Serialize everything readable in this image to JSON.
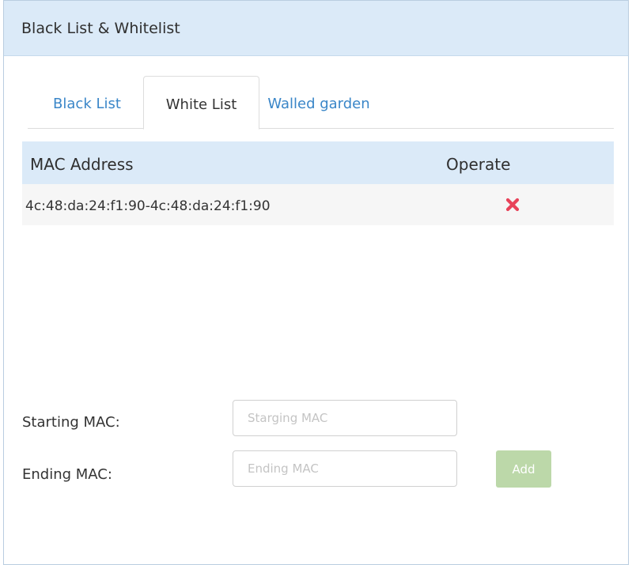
{
  "panel": {
    "title": "Black List & Whitelist"
  },
  "tabs": [
    {
      "label": "Black List",
      "active": false
    },
    {
      "label": "White List",
      "active": true
    },
    {
      "label": "Walled garden",
      "active": false
    }
  ],
  "table": {
    "columns": [
      "MAC Address",
      "Operate"
    ],
    "rows": [
      {
        "mac": "4c:48:da:24:f1:90-4c:48:da:24:f1:90",
        "operate_icon": "delete-x-icon"
      }
    ]
  },
  "form": {
    "starting_label": "Starting MAC:",
    "starting_placeholder": "Starging MAC",
    "starting_value": "",
    "ending_label": "Ending MAC:",
    "ending_placeholder": "Ending MAC",
    "ending_value": "",
    "add_label": "Add"
  },
  "colors": {
    "header_bg": "#dbeaf8",
    "tab_link": "#3a86c8",
    "delete_icon": "#e8435a",
    "add_button": "#bcd8a9"
  }
}
